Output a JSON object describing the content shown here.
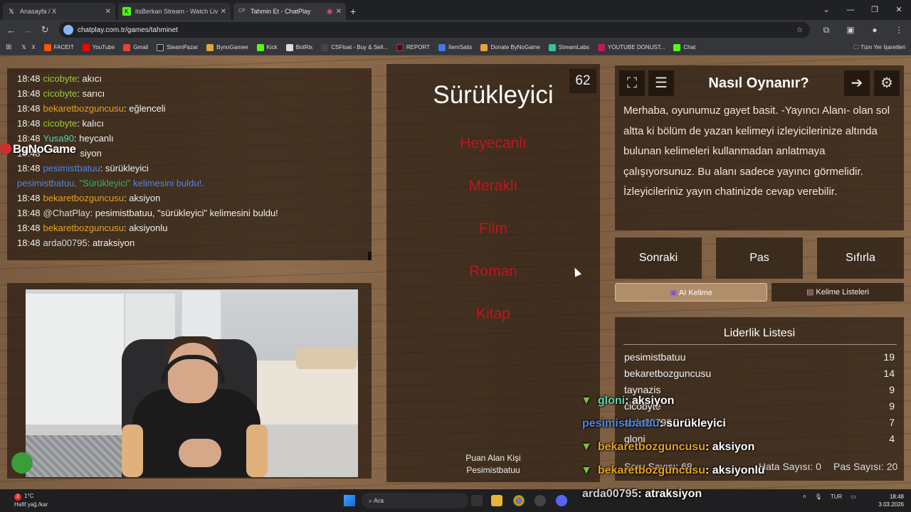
{
  "browser": {
    "tabs": [
      {
        "label": "Anasayfa / X",
        "icon": "x-icon"
      },
      {
        "label": "itsBerkan Stream - Watch Live o",
        "icon": "kick-icon"
      },
      {
        "label": "Tahmin Et - ChatPlay",
        "icon": "chatplay-icon"
      }
    ],
    "url": "chatplay.com.tr/games/tahminet",
    "bookmarks": [
      "X",
      "FACEIT",
      "YouTube",
      "Gmail",
      "SteamPazar",
      "BynoGamee",
      "Kick",
      "BotRix",
      "CSFloat - Buy & Sell...",
      "REPORT",
      "İtemSatis",
      "Donate ByNoGame",
      "StreamLabs",
      "YOUTUBE DONUST...",
      "Chat"
    ],
    "bookmarks_folder": "Tüm Yer İşaretleri"
  },
  "chat": {
    "lines": [
      {
        "time": "18:48",
        "user": "cicobyte",
        "color": "green",
        "msg": ": akıcı"
      },
      {
        "time": "18:48",
        "user": "cicobyte",
        "color": "green",
        "msg": ": sarıcı"
      },
      {
        "time": "18:48",
        "user": "bekaretbozguncusu",
        "color": "orange",
        "msg": ": eğlenceli"
      },
      {
        "time": "18:48",
        "user": "cicobyte",
        "color": "green",
        "msg": ": kalıcı"
      },
      {
        "time": "18:48",
        "user": "Yusa90",
        "color": "teal",
        "msg": ": heycanlı"
      },
      {
        "time": "18:48",
        "user": "",
        "color": "grey",
        "msg": "siyon"
      },
      {
        "time": "18:48",
        "user": "pesimistbatuu",
        "color": "blue",
        "msg": ": sürükleyici"
      },
      {
        "time": "18:48",
        "user": "@ChatPlay",
        "color": "grey",
        "msg": ": pesimistbatuu, \"sürükleyici\" kelimesini buldu!"
      },
      {
        "time": "18:48",
        "user": "bekaretbozguncusu",
        "color": "orange",
        "msg": ": aksiyonlu"
      },
      {
        "time": "18:48",
        "user": "arda00795",
        "color": "grey",
        "msg": ": atraksiyon"
      }
    ],
    "system_line": {
      "prefix": "pesimistbatuu, ",
      "word": "\"Sürükleyici\"",
      "suffix": " kelimesini buldu!."
    },
    "system_after": {
      "time": "18:48",
      "user": "bekaretbozguncusu",
      "msg": ": aksiyon"
    },
    "watermark": "BgNoGame"
  },
  "game": {
    "counter": "62",
    "main_word": "Sürükleyici",
    "taboo_words": [
      "Heyecanlı",
      "Meraklı",
      "Film",
      "Roman",
      "Kitap"
    ],
    "points_label": "Puan Alan Kişi",
    "points_user": "Pesimistbatuu"
  },
  "howto": {
    "title": "Nasıl Oynanır?",
    "text": "Merhaba, oyunumuz gayet basit. -Yayıncı Alanı- olan sol altta ki bölüm de yazan kelimeyi izleyicilerinize altında bulunan kelimeleri kullanmadan anlatmaya çalışıyorsunuz. Bu alanı sadece yayıncı görmelidir. İzleyicileriniz yayın chatinizde cevap verebilir."
  },
  "actions": {
    "next": "Sonraki",
    "pass": "Pas",
    "reset": "Sıfırla",
    "ai_tab": "AI Kelime",
    "lists_tab": "Kelime Listeleri"
  },
  "leaderboard": {
    "title": "Liderlik Listesi",
    "rows": [
      {
        "name": "pesimistbatuu",
        "score": "19"
      },
      {
        "name": "bekaretbozguncusu",
        "score": "14"
      },
      {
        "name": "taynazis",
        "score": "9"
      },
      {
        "name": "cicobyte",
        "score": "9"
      },
      {
        "name": "arda00795",
        "score": "7"
      },
      {
        "name": "gloni",
        "score": "4"
      }
    ],
    "question_count": "Soru Sayısı: 68",
    "error_count": "Hata Sayısı: 0",
    "pass_count": "Pas Sayısı: 20"
  },
  "overlay_chat": [
    {
      "user": "gloni",
      "msg": ": aksiyon",
      "gem": true,
      "color": "#5fd3b1"
    },
    {
      "user": "pesimistbatuu",
      "msg": ": sürükleyici",
      "gem": false,
      "color": "#4f86e8"
    },
    {
      "user": "bekaretbozguncusu",
      "msg": ": aksiyon",
      "gem": true,
      "color": "#e5a120"
    },
    {
      "user": "bekaretbozguncusu",
      "msg": ": aksiyonlu",
      "gem": true,
      "color": "#e5a120"
    },
    {
      "user": "arda00795",
      "msg": ": atraksiyon",
      "gem": false,
      "color": "#d0d0d0"
    }
  ],
  "taskbar": {
    "notif": "2",
    "temp": "1°C",
    "weather": "Hafif yağ./kar",
    "search": "Ara",
    "lang": "TUR",
    "time": "18:48",
    "date": "3.03.2026"
  }
}
